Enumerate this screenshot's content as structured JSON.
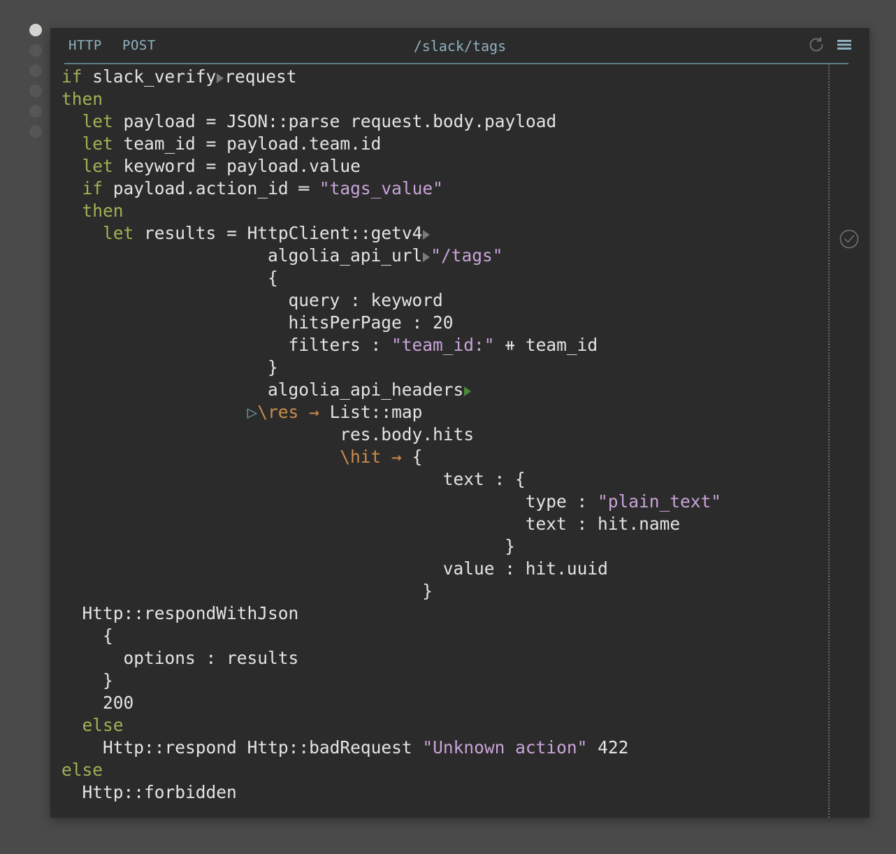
{
  "window": {
    "background_color": "#4a4a4a",
    "panel_color": "#2b2b2b"
  },
  "rail": {
    "dots": [
      {
        "name": "rail-dot-1",
        "active": true
      },
      {
        "name": "rail-dot-2",
        "active": false
      },
      {
        "name": "rail-dot-3",
        "active": false
      },
      {
        "name": "rail-dot-4",
        "active": false
      },
      {
        "name": "rail-dot-5",
        "active": false
      },
      {
        "name": "rail-dot-6",
        "active": false
      }
    ]
  },
  "header": {
    "method_protocol": "HTTP",
    "method_verb": "POST",
    "path": "/slack/tags",
    "accent_color": "#90b2c0",
    "refresh_icon": "refresh-icon",
    "menu_icon": "hamburger-menu-icon"
  },
  "status": {
    "check_icon": "circled-check-icon",
    "color": "#6f6f6f"
  },
  "code": {
    "language": "darklang",
    "lines": [
      {
        "n": 1,
        "text": "if slack_verify▶request"
      },
      {
        "n": 2,
        "text": "then"
      },
      {
        "n": 3,
        "text": "  let payload = JSON::parse request.body.payload"
      },
      {
        "n": 4,
        "text": "  let team_id = payload.team.id"
      },
      {
        "n": 5,
        "text": "  let keyword = payload.value"
      },
      {
        "n": 6,
        "text": "  if payload.action_id == \"tags_value\""
      },
      {
        "n": 7,
        "text": "  then"
      },
      {
        "n": 8,
        "text": "    let results = HttpClient::getv4▶"
      },
      {
        "n": 9,
        "text": "                    algolia_api_url▶\"/tags\""
      },
      {
        "n": 10,
        "text": "                    {"
      },
      {
        "n": 11,
        "text": "                      query : keyword"
      },
      {
        "n": 12,
        "text": "                      hitsPerPage : 20"
      },
      {
        "n": 13,
        "text": "                      filters : \"team_id:\" ++ team_id"
      },
      {
        "n": 14,
        "text": "                    }"
      },
      {
        "n": 15,
        "text": "                    algolia_api_headers▶"
      },
      {
        "n": 16,
        "text": "                  ▷\\res -> List::map"
      },
      {
        "n": 17,
        "text": "                           res.body.hits"
      },
      {
        "n": 18,
        "text": "                           \\hit -> {"
      },
      {
        "n": 19,
        "text": "                                     text : {"
      },
      {
        "n": 20,
        "text": "                                             type : \"plain_text\""
      },
      {
        "n": 21,
        "text": "                                             text : hit.name"
      },
      {
        "n": 22,
        "text": "                                           }"
      },
      {
        "n": 23,
        "text": "                                     value : hit.uuid"
      },
      {
        "n": 24,
        "text": "                                   }"
      },
      {
        "n": 25,
        "text": "  Http::respondWithJson"
      },
      {
        "n": 26,
        "text": "    {"
      },
      {
        "n": 27,
        "text": "      options : results"
      },
      {
        "n": 28,
        "text": "    }"
      },
      {
        "n": 29,
        "text": "    200"
      },
      {
        "n": 30,
        "text": "  else"
      },
      {
        "n": 31,
        "text": "    Http::respond Http::badRequest \"Unknown action\" 422"
      },
      {
        "n": 32,
        "text": "else"
      },
      {
        "n": 33,
        "text": "  Http::forbidden"
      }
    ],
    "tokens": {
      "keywords": [
        "if",
        "then",
        "else",
        "let"
      ],
      "strings": [
        "\"tags_value\"",
        "\"/tags\"",
        "\"team_id:\"",
        "\"plain_text\"",
        "\"Unknown action\""
      ],
      "lambdas": [
        "\\res",
        "\\hit"
      ],
      "numbers": [
        "20",
        "200",
        "422"
      ],
      "dim_annotations": [
        "v4"
      ],
      "functions": [
        "JSON::parse",
        "HttpClient::get",
        "List::map",
        "Http::respondWithJson",
        "Http::respond",
        "Http::badRequest",
        "Http::forbidden",
        "slack_verify",
        "algolia_api_url",
        "algolia_api_headers"
      ],
      "variables": [
        "request",
        "payload",
        "team_id",
        "keyword",
        "results",
        "res",
        "hit",
        "request.body.payload",
        "payload.team.id",
        "payload.value",
        "payload.action_id",
        "res.body.hits",
        "hit.name",
        "hit.uuid"
      ],
      "record_fields": [
        "query",
        "hitsPerPage",
        "filters",
        "text",
        "type",
        "value",
        "options"
      ],
      "operators": [
        "=",
        "==",
        "++",
        "->",
        ":"
      ]
    },
    "colors": {
      "keyword": "#a3b055",
      "string": "#c9a4d8",
      "lambda": "#cc8c4b",
      "dim": "#6f6f6f",
      "plain": "#e4e4e4",
      "triangle_gray": "#7a7a7a",
      "triangle_green": "#4a8a3a",
      "triangle_blue": "#6d95a5"
    }
  }
}
